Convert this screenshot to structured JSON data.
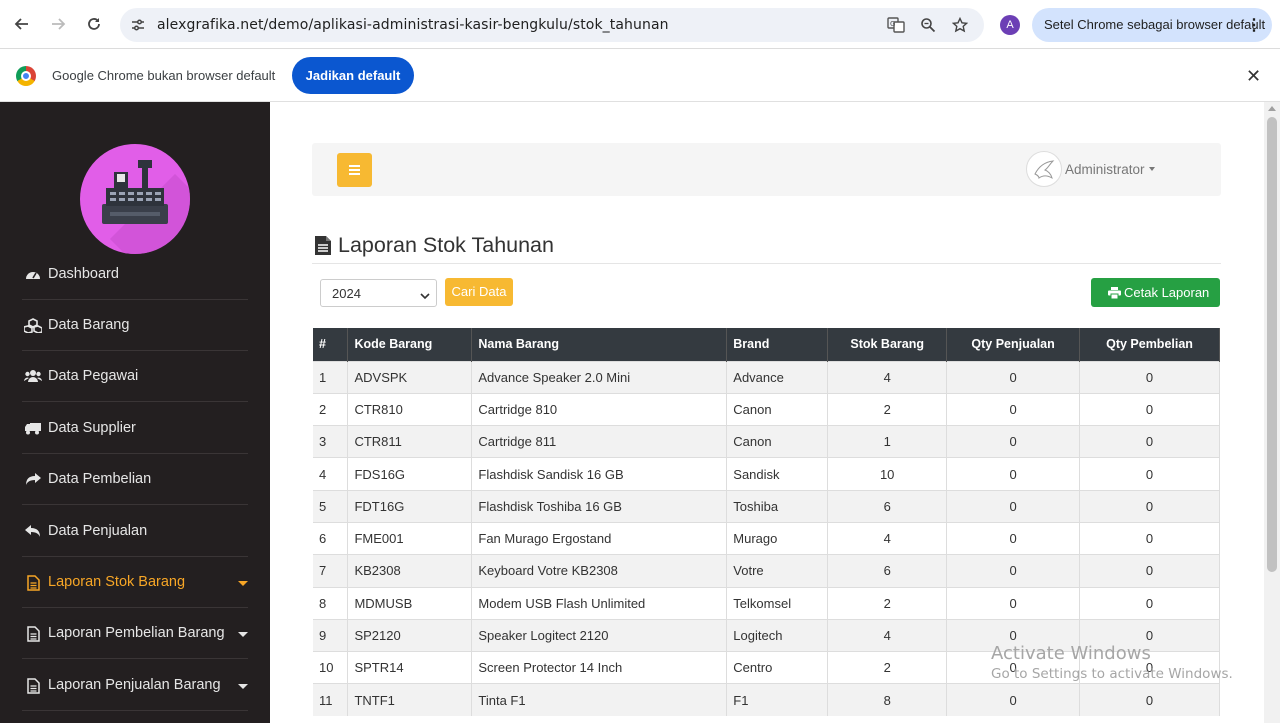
{
  "browser": {
    "url": "alexgrafika.net/demo/aplikasi-administrasi-kasir-bengkulu/stok_tahunan",
    "profile_initial": "A",
    "set_default_label": "Setel Chrome sebagai browser default",
    "infobar_message": "Google Chrome bukan browser default",
    "infobar_button": "Jadikan default"
  },
  "sidebar": {
    "items": [
      {
        "label": "Dashboard",
        "icon": "dashboard-icon"
      },
      {
        "label": "Data Barang",
        "icon": "cubes-icon"
      },
      {
        "label": "Data Pegawai",
        "icon": "users-icon"
      },
      {
        "label": "Data Supplier",
        "icon": "truck-icon"
      },
      {
        "label": "Data Pembelian",
        "icon": "share-icon"
      },
      {
        "label": "Data Penjualan",
        "icon": "reply-icon"
      },
      {
        "label": "Laporan Stok Barang",
        "icon": "file-icon",
        "active": true
      },
      {
        "label": "Laporan Pembelian Barang",
        "icon": "file-icon"
      },
      {
        "label": "Laporan Penjualan Barang",
        "icon": "file-icon"
      }
    ]
  },
  "header": {
    "user_name": "Administrator"
  },
  "page": {
    "title": "Laporan Stok Tahunan",
    "year_selected": "2024",
    "search_button": "Cari Data",
    "print_button": "Cetak Laporan"
  },
  "table": {
    "headers": [
      "#",
      "Kode Barang",
      "Nama Barang",
      "Brand",
      "Stok Barang",
      "Qty Penjualan",
      "Qty Pembelian"
    ],
    "rows": [
      [
        "1",
        "ADVSPK",
        "Advance Speaker 2.0 Mini",
        "Advance",
        "4",
        "0",
        "0"
      ],
      [
        "2",
        "CTR810",
        "Cartridge 810",
        "Canon",
        "2",
        "0",
        "0"
      ],
      [
        "3",
        "CTR811",
        "Cartridge 811",
        "Canon",
        "1",
        "0",
        "0"
      ],
      [
        "4",
        "FDS16G",
        "Flashdisk Sandisk 16 GB",
        "Sandisk",
        "10",
        "0",
        "0"
      ],
      [
        "5",
        "FDT16G",
        "Flashdisk Toshiba 16 GB",
        "Toshiba",
        "6",
        "0",
        "0"
      ],
      [
        "6",
        "FME001",
        "Fan Murago Ergostand",
        "Murago",
        "4",
        "0",
        "0"
      ],
      [
        "7",
        "KB2308",
        "Keyboard Votre KB2308",
        "Votre",
        "6",
        "0",
        "0"
      ],
      [
        "8",
        "MDMUSB",
        "Modem USB Flash Unlimited",
        "Telkomsel",
        "2",
        "0",
        "0"
      ],
      [
        "9",
        "SP2120",
        "Speaker Logitect 2120",
        "Logitech",
        "4",
        "0",
        "0"
      ],
      [
        "10",
        "SPTR14",
        "Screen Protector 14 Inch",
        "Centro",
        "2",
        "0",
        "0"
      ],
      [
        "11",
        "TNTF1",
        "Tinta F1",
        "F1",
        "8",
        "0",
        "0"
      ]
    ]
  },
  "watermark": {
    "line1": "Activate Windows",
    "line2": "Go to Settings to activate Windows."
  },
  "colors": {
    "sidebar_bg": "#231f20",
    "accent": "#f7a626",
    "print_button": "#26a043",
    "table_header": "#343a40"
  }
}
